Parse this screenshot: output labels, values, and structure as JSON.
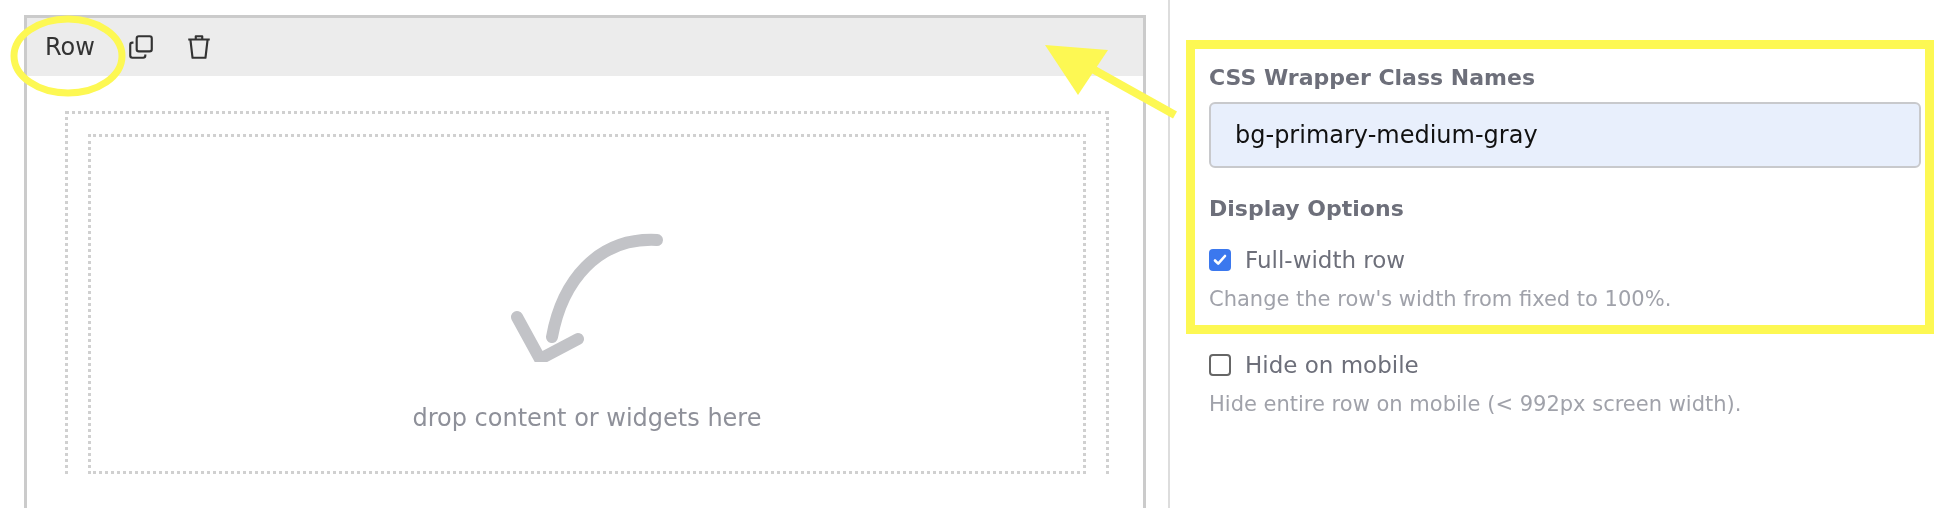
{
  "row_block": {
    "label": "Row",
    "drop_text": "drop content or widgets here"
  },
  "settings": {
    "highlighted": {
      "field": {
        "label": "CSS Wrapper Class Names",
        "value": "bg-primary-medium-gray"
      },
      "heading": "Display Options",
      "options": [
        {
          "label": "Full-width row",
          "checked": true,
          "hint": "Change the row's width from fixed to 100%."
        }
      ]
    },
    "options": [
      {
        "label": "Hide on mobile",
        "checked": false,
        "hint": "Hide entire row on mobile (< 992px screen width)."
      }
    ]
  }
}
